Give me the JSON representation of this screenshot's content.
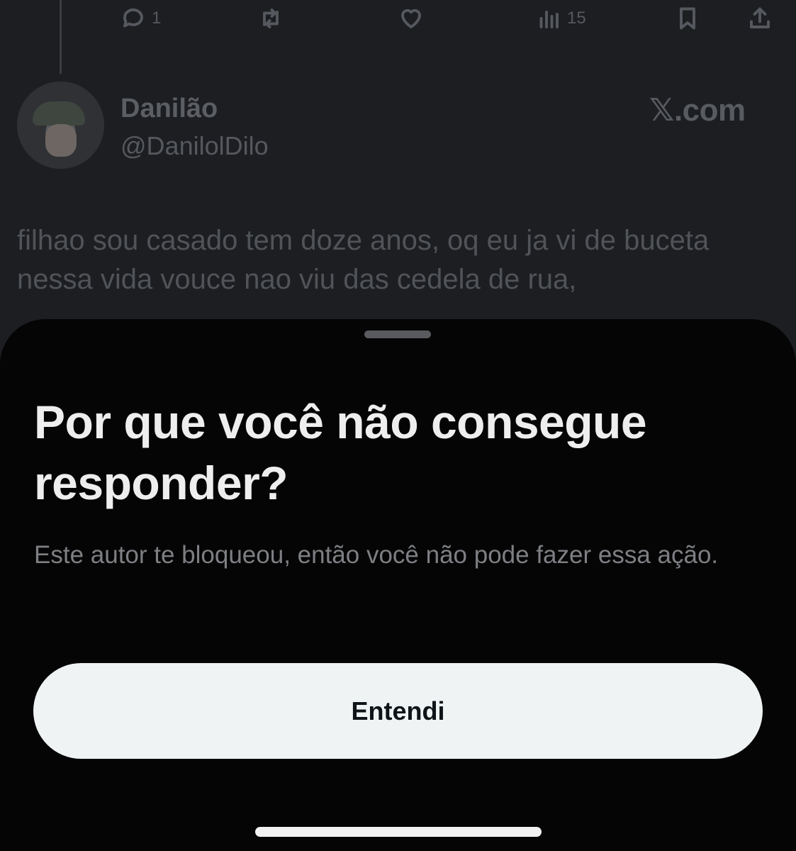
{
  "tweet": {
    "actions": {
      "reply_count": "1",
      "views_count": "15",
      "icons": [
        "reply-icon",
        "retweet-icon",
        "like-icon",
        "views-icon",
        "bookmark-icon",
        "share-icon"
      ]
    },
    "author_name": "Danilão",
    "author_handle": "@DanilolDilo",
    "source_label": "𝕏.com",
    "text": "filhao sou casado tem doze anos, oq eu ja vi de buceta nessa vida vouce nao viu das cedela de rua,"
  },
  "sheet": {
    "title": "Por que você não consegue responder?",
    "description": "Este autor te bloqueou, então você não pode fazer essa ação.",
    "button_label": "Entendi"
  },
  "colors": {
    "sheet_background": "#050505",
    "button_background": "#eff3f3",
    "title_color": "#eeeeee"
  }
}
